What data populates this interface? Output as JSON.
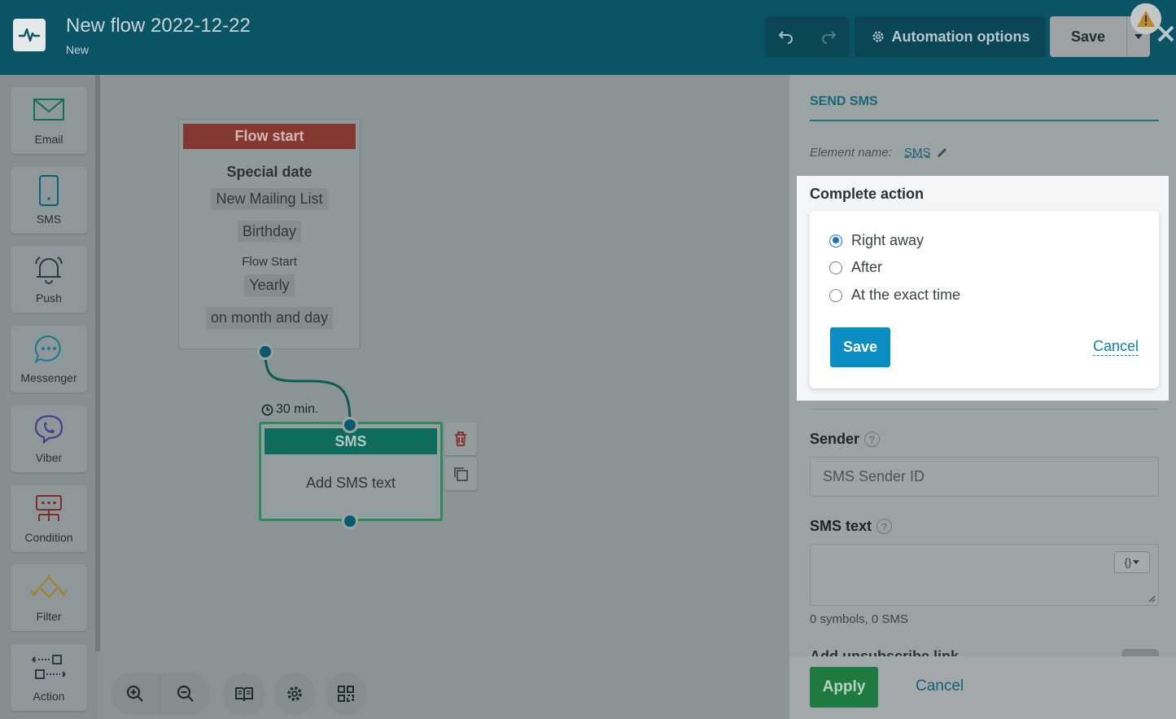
{
  "header": {
    "title": "New flow 2022-12-22",
    "status": "New",
    "automation_options": "Automation options",
    "save": "Save"
  },
  "palette": [
    {
      "label": "Email",
      "icon": "envelope-icon"
    },
    {
      "label": "SMS",
      "icon": "phone-icon"
    },
    {
      "label": "Push",
      "icon": "bell-icon"
    },
    {
      "label": "Messenger",
      "icon": "chat-bubble-icon"
    },
    {
      "label": "Viber",
      "icon": "viber-icon"
    },
    {
      "label": "Condition",
      "icon": "condition-icon"
    },
    {
      "label": "Filter",
      "icon": "filter-icon"
    },
    {
      "label": "Action",
      "icon": "action-icon"
    }
  ],
  "canvas": {
    "flow_start": {
      "header": "Flow start",
      "trigger": "Special date",
      "list": "New Mailing List",
      "field": "Birthday",
      "sub": "Flow Start",
      "period": "Yearly",
      "mode": "on month and day"
    },
    "delay": "30 min.",
    "sms_node": {
      "header": "SMS",
      "body": "Add SMS text"
    }
  },
  "panel": {
    "title": "SEND SMS",
    "element_name_label": "Element name:",
    "element_name_value": "SMS",
    "complete_action": {
      "title": "Complete action",
      "options": [
        "Right away",
        "After",
        "At the exact time"
      ],
      "selected": 0,
      "save": "Save",
      "cancel": "Cancel"
    },
    "sender_label": "Sender",
    "sender_placeholder": "SMS Sender ID",
    "sms_text_label": "SMS text",
    "counter": "0 symbols, 0 SMS",
    "cut_label": "Add unsubscribe link",
    "apply": "Apply",
    "cancel": "Cancel"
  },
  "colors": {
    "header_bg": "#0b5466",
    "accent": "#0a8ec1",
    "flow_start": "#853731",
    "sms_node": "#0e6c5c",
    "apply": "#1e7a41"
  }
}
